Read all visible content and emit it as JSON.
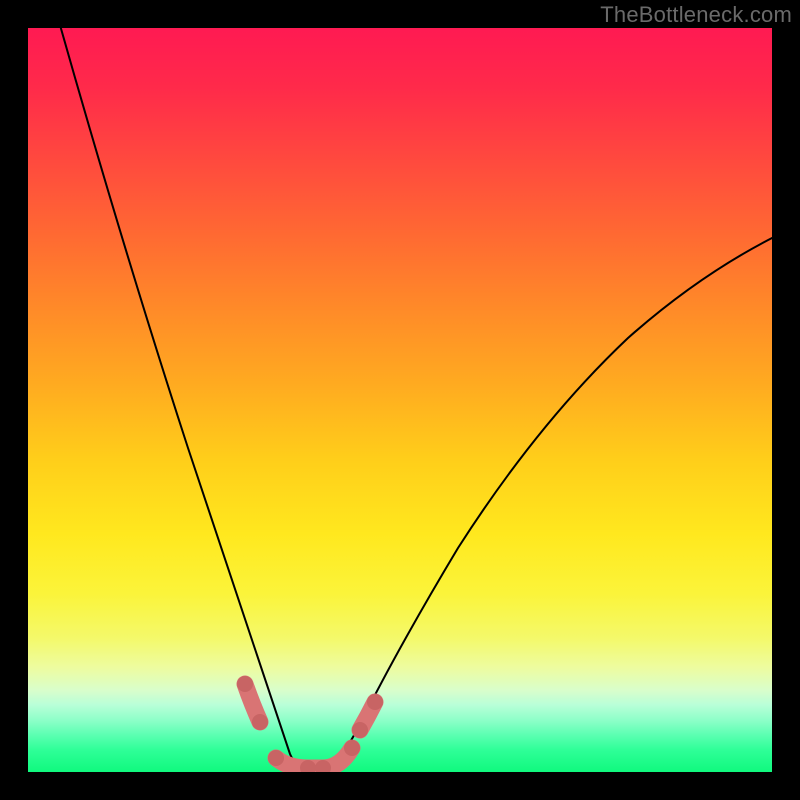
{
  "watermark": "TheBottleneck.com",
  "colors": {
    "page_bg": "#000000",
    "curve_stroke": "#000000",
    "marker_stroke": "#d97474",
    "marker_dot": "#c86464",
    "gradient_top": "#ff1a52",
    "gradient_bottom": "#10f97e"
  },
  "chart_data": {
    "type": "line",
    "title": "",
    "xlabel": "",
    "ylabel": "",
    "xlim": [
      0,
      100
    ],
    "ylim": [
      0,
      100
    ],
    "grid": false,
    "legend": false,
    "annotations": [],
    "series": [
      {
        "name": "left-curve",
        "x": [
          4,
          8,
          12,
          16,
          20,
          24,
          28,
          30,
          32,
          33,
          34,
          35,
          36
        ],
        "values": [
          100,
          83,
          67,
          52,
          38,
          25,
          12,
          7,
          4,
          2.5,
          1.5,
          1,
          1
        ]
      },
      {
        "name": "right-curve",
        "x": [
          40,
          42,
          45,
          50,
          55,
          60,
          66,
          72,
          80,
          88,
          96,
          100
        ],
        "values": [
          1,
          1.5,
          4,
          10,
          17,
          25,
          33,
          41,
          50,
          58,
          66,
          70
        ]
      }
    ],
    "markers": [
      {
        "series": "left-curve",
        "x": 28,
        "y": 12
      },
      {
        "series": "left-curve",
        "x": 30.5,
        "y": 6
      },
      {
        "series": "left-curve",
        "x": 33,
        "y": 1.5
      },
      {
        "series": "left-curve",
        "x": 35,
        "y": 1
      },
      {
        "series": "right-curve",
        "x": 40,
        "y": 1
      },
      {
        "series": "right-curve",
        "x": 42,
        "y": 2
      },
      {
        "series": "right-curve",
        "x": 44,
        "y": 5
      },
      {
        "series": "right-curve",
        "x": 46,
        "y": 8
      }
    ],
    "valley_band": {
      "x_range": [
        33,
        42
      ],
      "y": 1
    }
  }
}
